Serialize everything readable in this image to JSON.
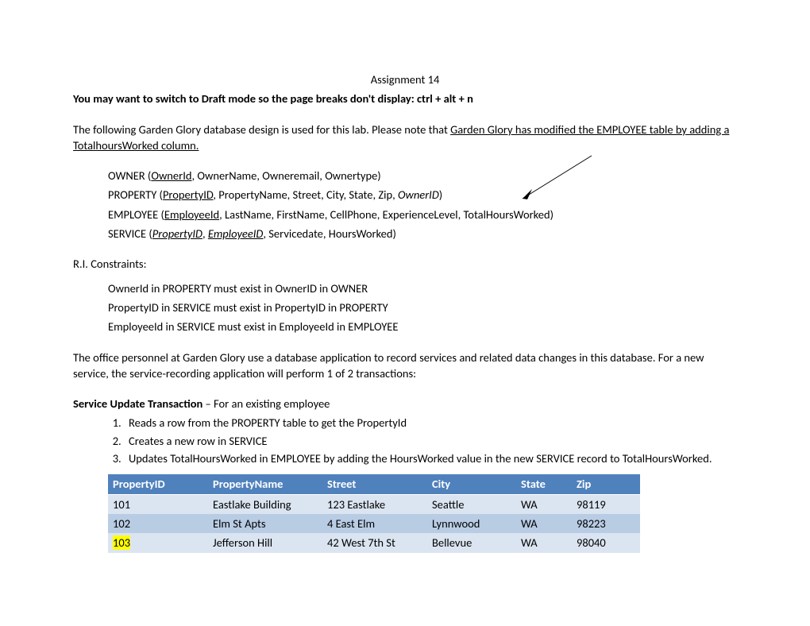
{
  "title": "Assignment 14",
  "hint": "You may want to switch to Draft mode so the page breaks don't display: ctrl + alt + n",
  "intro_pre": "The following Garden Glory database design is used for this lab. Please note that ",
  "intro_u1": "Garden Glory has modified the EMPLOYEE table by adding a",
  "intro_u2": "TotalhoursWorked column.",
  "schema": {
    "owner_pre": "OWNER (",
    "owner_pk": "OwnerId",
    "owner_rest": ", OwnerName, Owneremail, Ownertype)",
    "property_pre": "PROPERTY  (",
    "property_pk": "PropertyID",
    "property_mid": ", PropertyName, Street, City, State, Zip, ",
    "property_fk": "OwnerID",
    "property_end": ")",
    "employee_pre": "EMPLOYEE (",
    "employee_pk": "EmployeeId",
    "employee_rest": ", LastName, FirstName, CellPhone, ExperienceLevel, TotalHoursWorked)",
    "service_pre": "SERVICE (",
    "service_fk1": "PropertyID",
    "service_sep": ", ",
    "service_fk2": "EmployeeID",
    "service_rest": ", Servicedate, HoursWorked)"
  },
  "ri_heading": "R.I. Constraints:",
  "ri": [
    "OwnerId in PROPERTY must exist in OwnerID in OWNER",
    "PropertyID in SERVICE must exist in PropertyID in PROPERTY",
    "EmployeeId in SERVICE must exist in EmployeeId in EMPLOYEE"
  ],
  "office_para": "The office personnel at Garden Glory use a database application to record services and related data changes in this database. For a new service, the service-recording application will perform 1 of 2 transactions:",
  "sut_bold": "Service Update Transaction",
  "sut_rest": " – For an existing employee",
  "steps": [
    "Reads a row from the PROPERTY table to get the PropertyId",
    "Creates a new row in SERVICE",
    "Updates TotalHoursWorked in EMPLOYEE by adding the HoursWorked value in the new SERVICE record to TotalHoursWorked."
  ],
  "table": {
    "headers": [
      "PropertyID",
      "PropertyName",
      "Street",
      "City",
      "State",
      "Zip"
    ],
    "rows": [
      {
        "hl": false,
        "cells": [
          "101",
          "Eastlake Building",
          "123 Eastlake",
          "Seattle",
          "WA",
          "98119"
        ]
      },
      {
        "hl": false,
        "cells": [
          "102",
          "Elm St Apts",
          "4 East Elm",
          "Lynnwood",
          "WA",
          "98223"
        ]
      },
      {
        "hl": true,
        "cells": [
          "103",
          "Jefferson Hill",
          "42 West 7th St",
          "Bellevue",
          "WA",
          "98040"
        ]
      }
    ]
  }
}
